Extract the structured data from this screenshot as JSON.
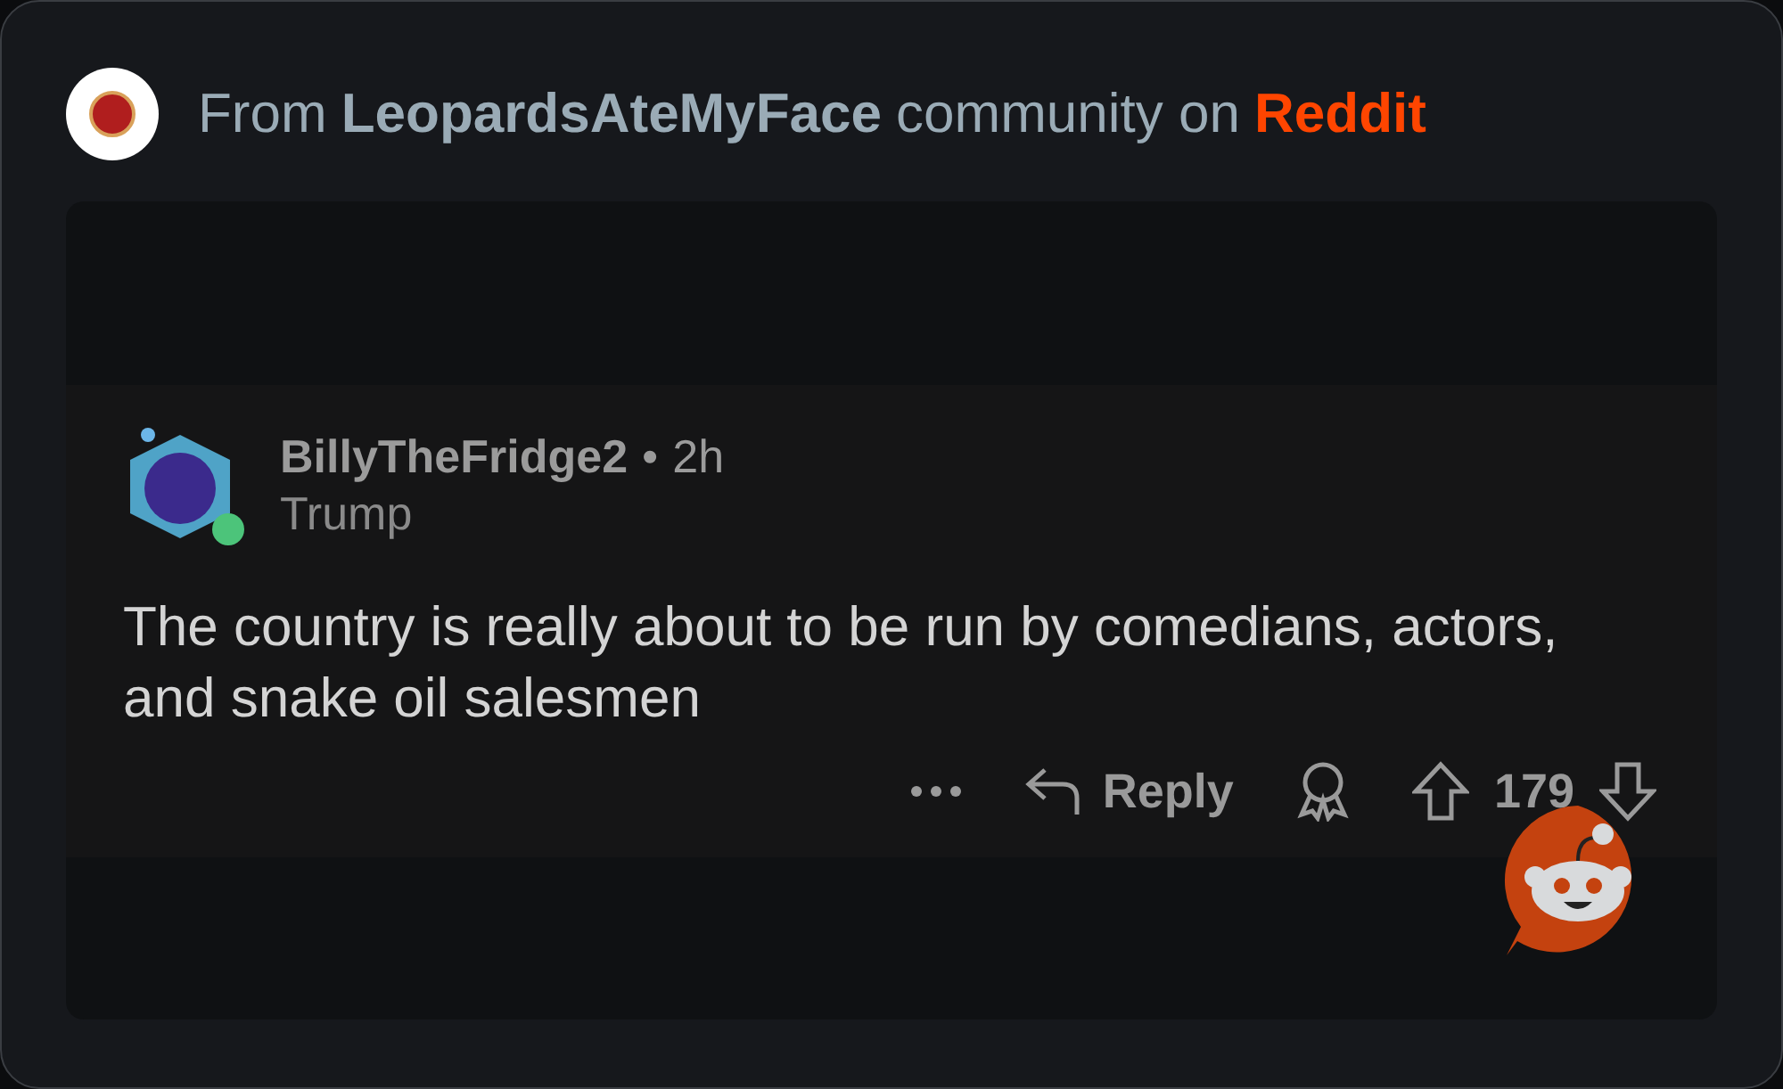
{
  "header": {
    "prefix": "From",
    "community": "LeopardsAteMyFace",
    "middle": "community on",
    "site": "Reddit"
  },
  "comment": {
    "author": "BillyTheFridge2",
    "separator": "•",
    "time": "2h",
    "flair": "Trump",
    "online": true,
    "body": "The country is really about to be run by comedians, actors, and snake oil salesmen",
    "actions": {
      "reply": "Reply",
      "score": "179"
    }
  }
}
